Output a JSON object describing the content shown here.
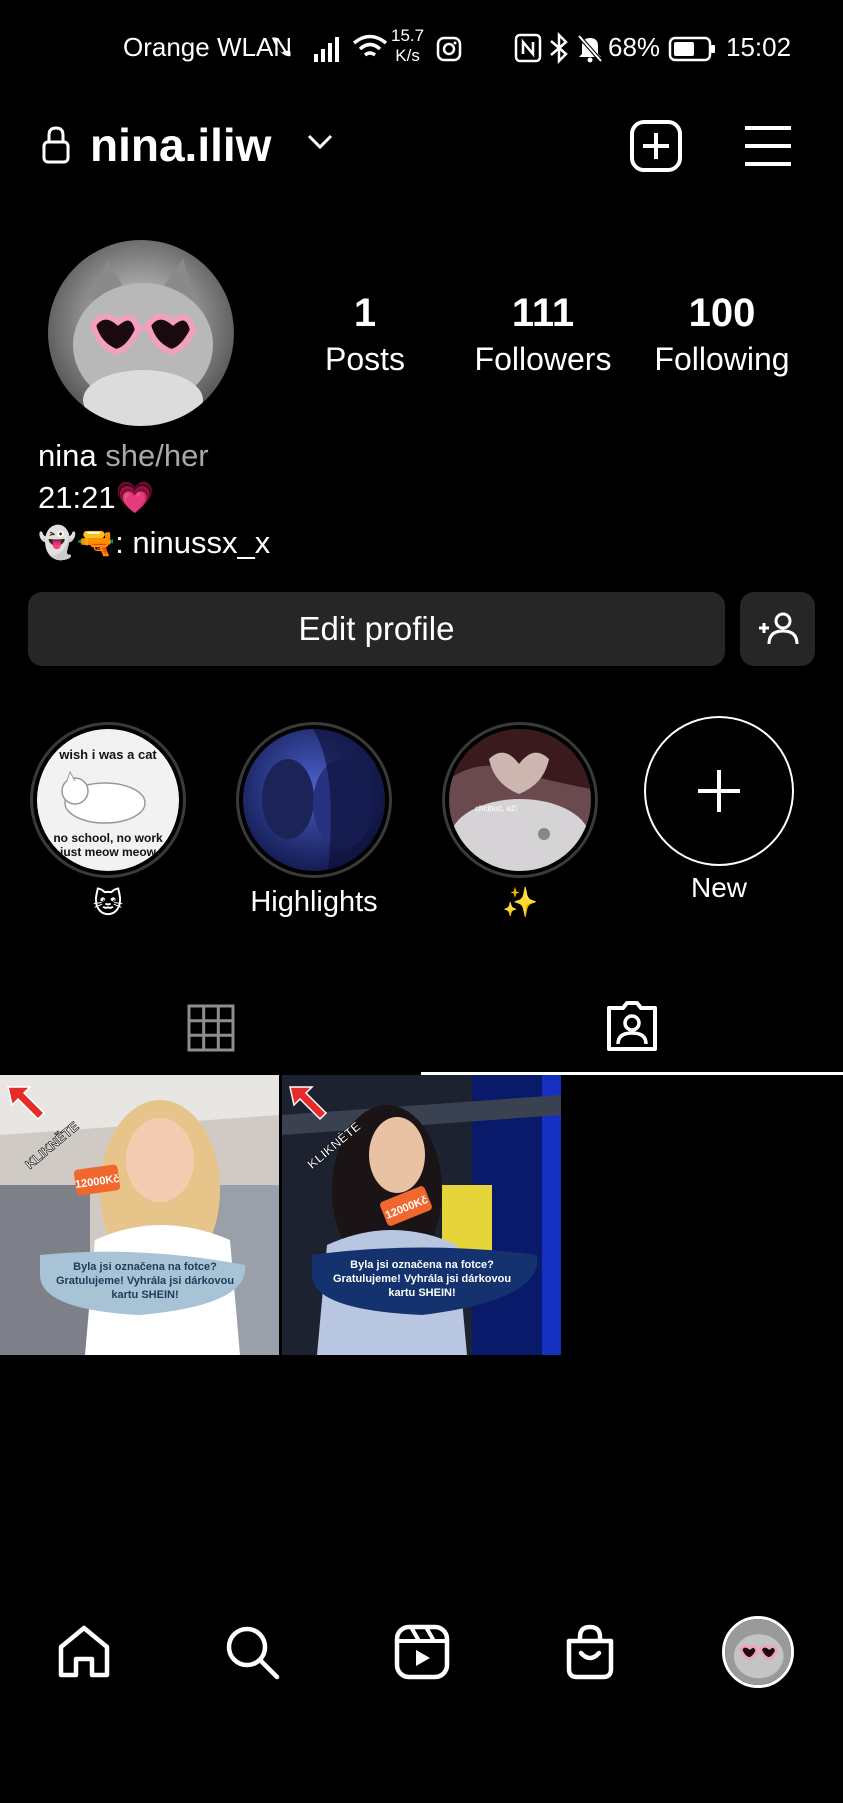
{
  "status_bar": {
    "carrier": "Orange WLAN",
    "speed_value": "15.7",
    "speed_unit": "K/s",
    "battery": "68%",
    "time": "15:02"
  },
  "header": {
    "username": "nina.iliw"
  },
  "profile": {
    "stats": [
      {
        "value": "1",
        "label": "Posts"
      },
      {
        "value": "111",
        "label": "Followers"
      },
      {
        "value": "100",
        "label": "Following"
      }
    ],
    "name": "nina",
    "pronouns": "she/her",
    "bio_line1": "21:21💗",
    "bio_line2": "👻🔫: ninussx_x"
  },
  "actions": {
    "edit_profile": "Edit profile"
  },
  "highlights": [
    {
      "label": "🐱",
      "top_text": "wish i was a cat",
      "bottom_text": "no school, no work just meow meow"
    },
    {
      "label": "Highlights"
    },
    {
      "label": "✨",
      "top_text": "chcibuć, až!"
    },
    {
      "label": "New"
    }
  ],
  "tagged_posts": [
    {
      "corner_text": "KLIKNĚTE",
      "card_text": "12000Kč",
      "caption": "Byla jsi označena na fotce? Gratulujeme! Vyhrála jsi dárkovou kartu SHEIN!"
    },
    {
      "corner_text": "KLIKNĚTE",
      "card_text": "12000Kč",
      "caption": "Byla jsi označena na fotce? Gratulujeme! Vyhrála jsi dárkovou kartu SHEIN!"
    }
  ],
  "icons": {
    "lock": "lock-icon",
    "chevron": "chevron-down-icon",
    "create": "plus-square-icon",
    "menu": "hamburger-menu-icon",
    "discover": "add-person-icon",
    "grid": "grid-icon",
    "tagged": "tagged-person-icon",
    "home": "home-icon",
    "search": "search-icon",
    "reels": "reels-icon",
    "shop": "shopping-bag-icon"
  }
}
